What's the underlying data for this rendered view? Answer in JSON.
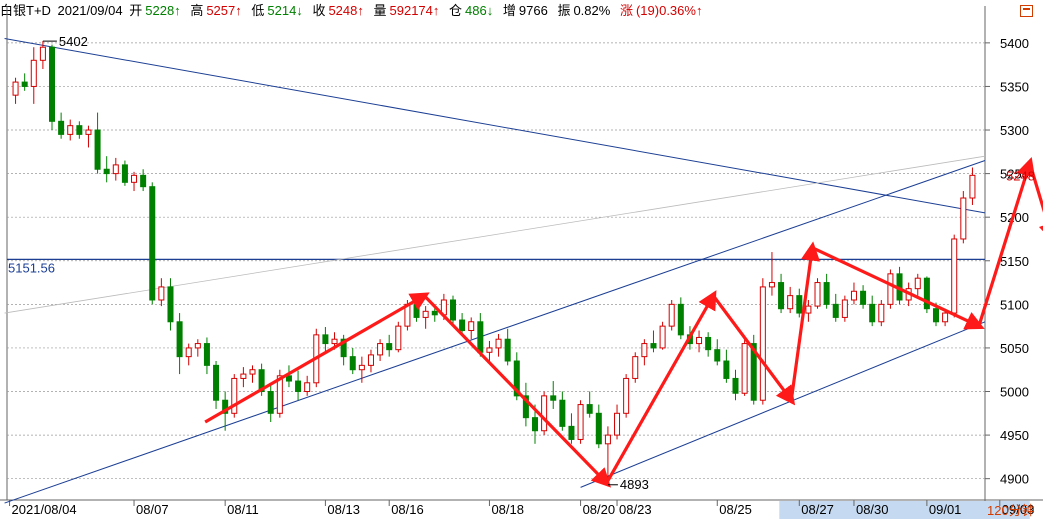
{
  "header": {
    "title": "白银T+D",
    "date": "2021/09/04",
    "open_label": "开",
    "open": "5228↑",
    "high_label": "高",
    "high": "5257↑",
    "low_label": "低",
    "low": "5214↓",
    "close_label": "收",
    "close": "5248↑",
    "volume_label": "量",
    "volume": "592174↑",
    "oi_label": "仓",
    "oi": "486↓",
    "oi_change_label": "增",
    "oi_change": "9766",
    "amplitude_label": "振",
    "amplitude": "0.82%",
    "change_label": "涨",
    "change": "(19)0.36%↑"
  },
  "period_label": "120分钟",
  "colors": {
    "up": "#d40000",
    "down": "#008000",
    "trendline": "#1c3f94",
    "arrow": "#ff1a1a",
    "grid": "#999999",
    "axis_highlight": "#c5d9f1"
  },
  "chart_data": {
    "type": "candlestick",
    "y_ticks": [
      4900,
      4950,
      5000,
      5050,
      5100,
      5150,
      5200,
      5250,
      5300,
      5350,
      5400
    ],
    "ylim": [
      4887,
      5440
    ],
    "x_tick_labels": [
      "2021/08/04",
      "08/07",
      "08/11",
      "08/13",
      "08/16",
      "08/18",
      "08/20",
      "08/23",
      "08/25",
      "08/27",
      "08/30",
      "09/01",
      "09/03"
    ],
    "highlighted_x_ticks": [
      "08/27",
      "08/30",
      "09/01",
      "09/03"
    ],
    "last_price_label": "5248",
    "level_line": {
      "value": 5151.56,
      "label": "5151.56"
    },
    "high_annotation": {
      "value": 5402,
      "label": "5402"
    },
    "low_annotation": {
      "value": 4893,
      "label": "4893"
    },
    "candles_ohlc": [
      [
        5340,
        5360,
        5330,
        5355
      ],
      [
        5355,
        5365,
        5345,
        5350
      ],
      [
        5350,
        5395,
        5330,
        5380
      ],
      [
        5380,
        5402,
        5370,
        5395
      ],
      [
        5395,
        5398,
        5300,
        5310
      ],
      [
        5310,
        5320,
        5290,
        5295
      ],
      [
        5295,
        5312,
        5288,
        5305
      ],
      [
        5305,
        5310,
        5290,
        5295
      ],
      [
        5295,
        5305,
        5280,
        5300
      ],
      [
        5300,
        5320,
        5250,
        5255
      ],
      [
        5255,
        5270,
        5240,
        5250
      ],
      [
        5250,
        5268,
        5242,
        5260
      ],
      [
        5260,
        5265,
        5236,
        5240
      ],
      [
        5240,
        5252,
        5230,
        5248
      ],
      [
        5248,
        5255,
        5230,
        5235
      ],
      [
        5235,
        5240,
        5100,
        5105
      ],
      [
        5105,
        5130,
        5098,
        5120
      ],
      [
        5120,
        5130,
        5070,
        5080
      ],
      [
        5080,
        5090,
        5020,
        5040
      ],
      [
        5040,
        5055,
        5030,
        5050
      ],
      [
        5050,
        5060,
        5040,
        5055
      ],
      [
        5055,
        5062,
        5020,
        5030
      ],
      [
        5030,
        5035,
        4980,
        4990
      ],
      [
        4990,
        5000,
        4955,
        4975
      ],
      [
        4975,
        5020,
        4970,
        5015
      ],
      [
        5015,
        5028,
        5005,
        5020
      ],
      [
        5020,
        5030,
        5010,
        5025
      ],
      [
        5025,
        5032,
        4995,
        5000
      ],
      [
        5000,
        5010,
        4965,
        4975
      ],
      [
        4975,
        5025,
        4970,
        5018
      ],
      [
        5018,
        5030,
        5005,
        5012
      ],
      [
        5012,
        5024,
        4990,
        5000
      ],
      [
        5000,
        5018,
        4995,
        5010
      ],
      [
        5010,
        5072,
        5005,
        5065
      ],
      [
        5065,
        5074,
        5045,
        5055
      ],
      [
        5055,
        5068,
        5048,
        5060
      ],
      [
        5060,
        5065,
        5030,
        5040
      ],
      [
        5040,
        5050,
        5020,
        5025
      ],
      [
        5025,
        5040,
        5010,
        5030
      ],
      [
        5030,
        5048,
        5022,
        5042
      ],
      [
        5042,
        5060,
        5035,
        5055
      ],
      [
        5055,
        5065,
        5040,
        5048
      ],
      [
        5048,
        5080,
        5045,
        5075
      ],
      [
        5075,
        5105,
        5070,
        5100
      ],
      [
        5100,
        5108,
        5080,
        5085
      ],
      [
        5085,
        5098,
        5072,
        5092
      ],
      [
        5092,
        5100,
        5080,
        5088
      ],
      [
        5088,
        5112,
        5082,
        5105
      ],
      [
        5105,
        5110,
        5078,
        5082
      ],
      [
        5082,
        5090,
        5066,
        5070
      ],
      [
        5070,
        5085,
        5060,
        5080
      ],
      [
        5080,
        5090,
        5040,
        5045
      ],
      [
        5045,
        5058,
        5032,
        5050
      ],
      [
        5050,
        5066,
        5040,
        5060
      ],
      [
        5060,
        5072,
        5030,
        5035
      ],
      [
        5035,
        5045,
        4990,
        4995
      ],
      [
        4995,
        5010,
        4960,
        4970
      ],
      [
        4970,
        4985,
        4940,
        4955
      ],
      [
        4955,
        5000,
        4950,
        4995
      ],
      [
        4995,
        5012,
        4980,
        4990
      ],
      [
        4990,
        5000,
        4955,
        4960
      ],
      [
        4960,
        4975,
        4940,
        4945
      ],
      [
        4945,
        4990,
        4940,
        4985
      ],
      [
        4985,
        5000,
        4970,
        4975
      ],
      [
        4975,
        4985,
        4935,
        4940
      ],
      [
        4940,
        4960,
        4893,
        4950
      ],
      [
        4950,
        4985,
        4945,
        4975
      ],
      [
        4975,
        5020,
        4970,
        5015
      ],
      [
        5015,
        5045,
        5010,
        5040
      ],
      [
        5040,
        5060,
        5030,
        5055
      ],
      [
        5055,
        5070,
        5045,
        5050
      ],
      [
        5050,
        5080,
        5048,
        5075
      ],
      [
        5075,
        5105,
        5070,
        5100
      ],
      [
        5100,
        5108,
        5060,
        5065
      ],
      [
        5065,
        5075,
        5048,
        5055
      ],
      [
        5055,
        5070,
        5045,
        5062
      ],
      [
        5062,
        5068,
        5040,
        5048
      ],
      [
        5048,
        5060,
        5030,
        5035
      ],
      [
        5035,
        5048,
        5010,
        5015
      ],
      [
        5015,
        5025,
        4990,
        4998
      ],
      [
        4998,
        5060,
        4995,
        5055
      ],
      [
        5055,
        5065,
        4985,
        4990
      ],
      [
        4990,
        5130,
        4985,
        5120
      ],
      [
        5120,
        5160,
        5110,
        5125
      ],
      [
        5125,
        5135,
        5090,
        5095
      ],
      [
        5095,
        5120,
        5090,
        5110
      ],
      [
        5110,
        5118,
        5085,
        5090
      ],
      [
        5090,
        5105,
        5080,
        5098
      ],
      [
        5098,
        5130,
        5095,
        5125
      ],
      [
        5125,
        5135,
        5095,
        5100
      ],
      [
        5100,
        5112,
        5080,
        5085
      ],
      [
        5085,
        5110,
        5080,
        5105
      ],
      [
        5105,
        5125,
        5100,
        5115
      ],
      [
        5115,
        5122,
        5095,
        5100
      ],
      [
        5100,
        5110,
        5075,
        5080
      ],
      [
        5080,
        5105,
        5075,
        5100
      ],
      [
        5100,
        5140,
        5095,
        5135
      ],
      [
        5135,
        5143,
        5100,
        5105
      ],
      [
        5105,
        5125,
        5098,
        5118
      ],
      [
        5118,
        5135,
        5110,
        5130
      ],
      [
        5130,
        5132,
        5090,
        5095
      ],
      [
        5095,
        5102,
        5075,
        5080
      ],
      [
        5080,
        5095,
        5075,
        5090
      ],
      [
        5090,
        5180,
        5085,
        5175
      ],
      [
        5175,
        5230,
        5170,
        5222
      ],
      [
        5222,
        5257,
        5214,
        5248
      ]
    ],
    "trend_lines": [
      {
        "from": [
          "2021/08/04",
          5405
        ],
        "to": [
          "09/03",
          5205
        ]
      },
      {
        "from": [
          "2021/08/04",
          4872
        ],
        "to": [
          "09/03",
          5265
        ]
      },
      {
        "from": [
          "08/20",
          4890
        ],
        "to": [
          "09/03",
          5080
        ]
      },
      {
        "from": [
          "2021/08/04",
          5090
        ],
        "to": [
          "09/03",
          5270
        ]
      }
    ],
    "arrow_path": [
      [
        "08/11",
        4965
      ],
      [
        "08/16",
        5110
      ],
      [
        "08/20",
        4895
      ],
      [
        "08/25",
        5110
      ],
      [
        "08/27",
        4990
      ],
      [
        "08/27",
        5165
      ],
      [
        "09/01",
        5075
      ],
      [
        "09/03",
        5262
      ],
      [
        "09/03",
        5178
      ],
      [
        "09/03",
        5340
      ]
    ]
  }
}
